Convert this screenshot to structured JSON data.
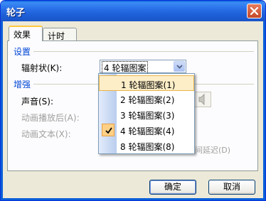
{
  "window": {
    "title": "轮子"
  },
  "tabs": [
    {
      "label": "效果",
      "active": true
    },
    {
      "label": "计时",
      "active": false
    }
  ],
  "settings_group": {
    "title": "设置",
    "spokes_label": "辐射状(K):",
    "spokes_value": "4 轮辐图案"
  },
  "dropdown": {
    "options": [
      {
        "label": "1 轮辐图案(1)",
        "highlighted": true,
        "checked": false
      },
      {
        "label": "2 轮辐图案(2)",
        "highlighted": false,
        "checked": false
      },
      {
        "label": "3 轮辐图案(3)",
        "highlighted": false,
        "checked": false
      },
      {
        "label": "4 轮辐图案(4)",
        "highlighted": false,
        "checked": true
      },
      {
        "label": "8 轮辐图案(8)",
        "highlighted": false,
        "checked": false
      }
    ]
  },
  "enhance_group": {
    "title": "增强",
    "sound_label": "声音(S):",
    "after_animation_label": "动画播放后(A):",
    "animate_text_label": "动画文本(X):",
    "delay_label_partial": "间延迟(D)"
  },
  "buttons": {
    "ok": "确定",
    "cancel": "取消"
  },
  "colors": {
    "title_bar": "#0a5fd8",
    "group_title": "#0046d5",
    "highlight": "#fdeec8"
  }
}
